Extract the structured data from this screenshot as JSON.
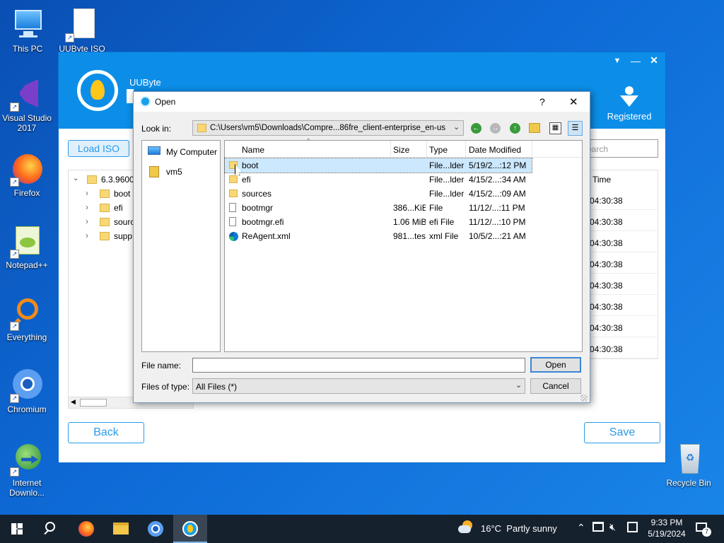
{
  "desktop": {
    "icons": [
      {
        "label": "This PC"
      },
      {
        "label": "UUByte ISO"
      },
      {
        "label": "Visual Studio 2017"
      },
      {
        "label": "Firefox"
      },
      {
        "label": "Notepad++"
      },
      {
        "label": "Everything"
      },
      {
        "label": "Chromium"
      },
      {
        "label": "Internet Downlo..."
      },
      {
        "label": "Recycle Bin"
      }
    ]
  },
  "app": {
    "brand": "UUByte",
    "registered_label": "Registered",
    "load_iso_label": "Load ISO",
    "search_placeholder": "earch",
    "tree": {
      "root": "6.3.9600.",
      "children": [
        "boot",
        "efi",
        "sourc",
        "supp"
      ]
    },
    "time_header": "Time",
    "times": [
      "04:30:38",
      "04:30:38",
      "04:30:38",
      "04:30:38",
      "04:30:38",
      "04:30:38",
      "04:30:38",
      "04:30:38"
    ],
    "back_label": "Back",
    "save_label": "Save",
    "accent": "#0c8ee8"
  },
  "dialog": {
    "title": "Open",
    "help": "?",
    "close": "✕",
    "look_in_label": "Look in:",
    "look_in_value": "C:\\Users\\vm5\\Downloads\\Compre...86fre_client-enterprise_en-us",
    "places": [
      {
        "label": "My Computer"
      },
      {
        "label": "vm5"
      }
    ],
    "columns": {
      "name": "Name",
      "size": "Size",
      "type": "Type",
      "date": "Date Modified"
    },
    "files": [
      {
        "name": "boot",
        "size": "",
        "type": "File...lder",
        "date": "5/19/2...:12 PM",
        "kind": "folder"
      },
      {
        "name": "efi",
        "size": "",
        "type": "File...lder",
        "date": "4/15/2...:34 AM",
        "kind": "folder"
      },
      {
        "name": "sources",
        "size": "",
        "type": "File...lder",
        "date": "4/15/2...:09 AM",
        "kind": "folder"
      },
      {
        "name": "bootmgr",
        "size": "386...KiB",
        "type": "File",
        "date": "11/12/...:11 PM",
        "kind": "file"
      },
      {
        "name": "bootmgr.efi",
        "size": "1.06 MiB",
        "type": "efi File",
        "date": "11/12/...:10 PM",
        "kind": "file"
      },
      {
        "name": "ReAgent.xml",
        "size": "981...tes",
        "type": "xml File",
        "date": "10/5/2...:21 AM",
        "kind": "edge"
      }
    ],
    "file_name_label": "File name:",
    "file_name_value": "",
    "files_of_type_label": "Files of type:",
    "files_of_type_value": "All Files (*)",
    "open_label": "Open",
    "cancel_label": "Cancel"
  },
  "taskbar": {
    "weather": "16°C  Partly sunny",
    "time": "9:33 PM",
    "date": "5/19/2024",
    "notifications": "7"
  }
}
